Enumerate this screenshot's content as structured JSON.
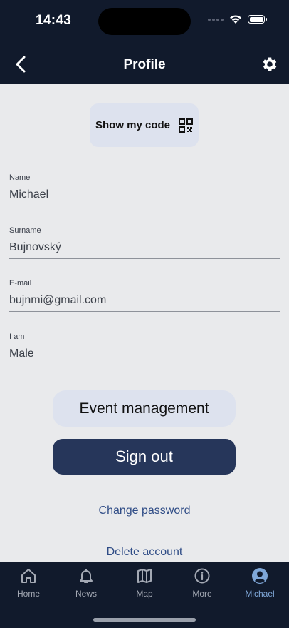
{
  "status_bar": {
    "time": "14:43"
  },
  "header": {
    "title": "Profile"
  },
  "code_button": {
    "label": "Show my code"
  },
  "fields": [
    {
      "label": "Name",
      "value": "Michael"
    },
    {
      "label": "Surname",
      "value": "Bujnovský"
    },
    {
      "label": "E-mail",
      "value": "bujnmi@gmail.com"
    },
    {
      "label": "I am",
      "value": "Male"
    }
  ],
  "actions": {
    "event_management": "Event management",
    "sign_out": "Sign out",
    "change_password": "Change password",
    "delete_account": "Delete account"
  },
  "tabs": [
    {
      "label": "Home",
      "icon": "home-icon"
    },
    {
      "label": "News",
      "icon": "bell-icon"
    },
    {
      "label": "Map",
      "icon": "map-icon"
    },
    {
      "label": "More",
      "icon": "info-icon"
    },
    {
      "label": "Michael",
      "icon": "user-icon",
      "active": true
    }
  ],
  "colors": {
    "header_bg": "#111a2c",
    "primary_button": "#26365a",
    "secondary_button": "#dde2ee",
    "link": "#2f4c86",
    "active_tab": "#7fa7d8"
  }
}
